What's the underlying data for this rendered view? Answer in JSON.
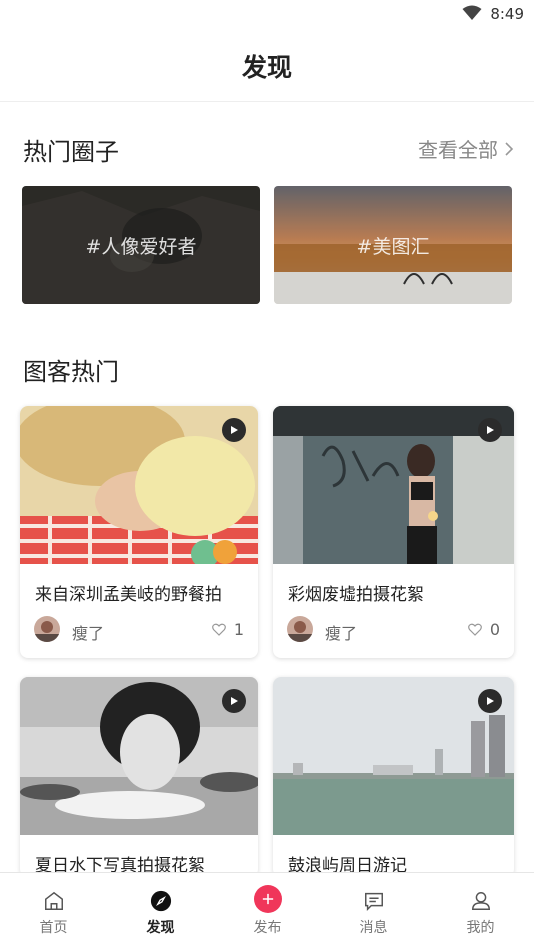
{
  "status_bar": {
    "time": "8:49"
  },
  "header": {
    "title": "发现"
  },
  "hot_circles": {
    "title": "热门圈子",
    "see_all": "查看全部",
    "items": [
      {
        "label": "#人像爱好者"
      },
      {
        "label": "#美图汇"
      }
    ]
  },
  "hot_posts": {
    "title": "图客热门",
    "items": [
      {
        "caption": "来自深圳孟美岐的野餐拍",
        "author": "瘦了",
        "likes": "1"
      },
      {
        "caption": "彩烟废墟拍摄花絮",
        "author": "瘦了",
        "likes": "0"
      },
      {
        "caption": "夏日水下写真拍摄花絮",
        "author": "",
        "likes": ""
      },
      {
        "caption": "鼓浪屿周日游记",
        "author": "",
        "likes": ""
      }
    ]
  },
  "tab_bar": {
    "items": [
      {
        "label": "首页",
        "icon": "home-icon"
      },
      {
        "label": "发现",
        "icon": "compass-icon"
      },
      {
        "label": "发布",
        "icon": "plus-icon"
      },
      {
        "label": "消息",
        "icon": "message-icon"
      },
      {
        "label": "我的",
        "icon": "user-icon"
      }
    ],
    "active": "发现",
    "publish_color": "#f0365a"
  }
}
